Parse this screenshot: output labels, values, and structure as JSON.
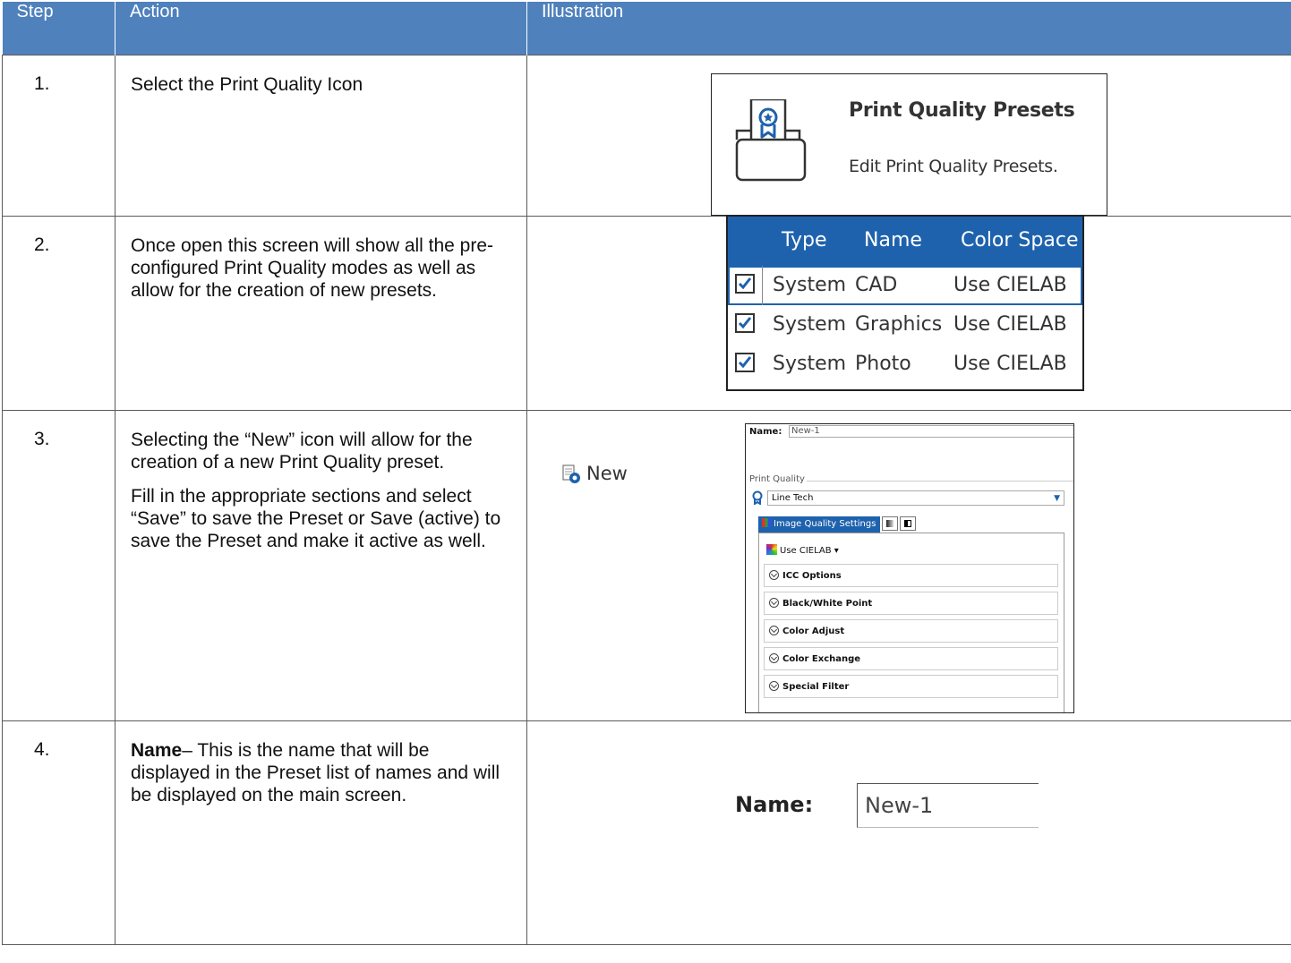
{
  "headers": [
    "Step",
    "Action",
    "Illustration"
  ],
  "rows": [
    {
      "step": "1.",
      "action": [
        "Select the Print Quality Icon"
      ],
      "illustration": {
        "title": "Print Quality Presets",
        "subtitle": "Edit Print Quality Presets.",
        "icon": "print-quality-icon"
      }
    },
    {
      "step": "2.",
      "action": [
        "Once open this screen will show all the pre-configured Print Quality modes as well as allow for the creation of new presets."
      ],
      "illustration": {
        "columns": [
          "Type",
          "Name",
          "Color Space"
        ],
        "rows": [
          {
            "checked": true,
            "type": "System",
            "name": "CAD",
            "color_space": "Use CIELAB"
          },
          {
            "checked": true,
            "type": "System",
            "name": "Graphics",
            "color_space": "Use CIELAB"
          },
          {
            "checked": true,
            "type": "System",
            "name": "Photo",
            "color_space": "Use CIELAB"
          }
        ]
      }
    },
    {
      "step": "3.",
      "action": [
        "Selecting the “New” icon will allow for the creation of a new Print Quality preset.",
        "Fill in the appropriate sections and select “Save” to save the Preset or Save (active) to save the Preset and make it active as well."
      ],
      "illustration": {
        "new_label": "New",
        "name_label": "Name:",
        "name_value": "New-1",
        "group_label": "Print Quality",
        "print_quality_selected": "Line Tech",
        "tab_label": "Image Quality Settings",
        "color_mode": "Use CIELAB ▾",
        "sections": [
          "ICC Options",
          "Black/White Point",
          "Color Adjust",
          "Color Exchange",
          "Special Filter"
        ]
      }
    },
    {
      "step": "4.",
      "action_bold": "Name",
      "action_rest": "– This is the name that will be displayed in the Preset list of names and will be displayed on the main screen.",
      "illustration": {
        "name_label": "Name:",
        "name_value": "New-1"
      }
    }
  ],
  "colors": {
    "header_bg": "#4f81bd",
    "accent_blue": "#1e62ad"
  }
}
